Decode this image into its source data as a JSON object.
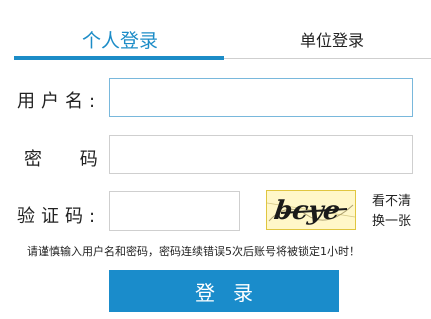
{
  "tabs": {
    "personal_label": "个人登录",
    "unit_label": "单位登录",
    "active_tab": "personal"
  },
  "form": {
    "username_label": "用户名:",
    "username_value": "",
    "password_label": "密 码:",
    "password_value": "",
    "captcha_label": "验证码:",
    "captcha_value": "",
    "captcha_image_text": "bcye",
    "refresh_label": "看不清换一张"
  },
  "notice": "请谨慎输入用户名和密码，密码连续错误5次后账号将被锁定1小时！",
  "login_button_label": "登录",
  "colors": {
    "accent": "#1c8cc7",
    "button": "#1a8ccb",
    "captcha_bg": "#fffbd6",
    "captcha_border": "#e0c640"
  }
}
